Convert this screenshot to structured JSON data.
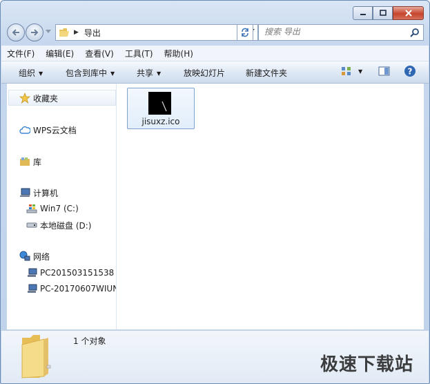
{
  "window": {
    "caption_buttons": [
      "minimize",
      "maximize",
      "close"
    ]
  },
  "address": {
    "crumb": "导出"
  },
  "search": {
    "placeholder": "搜索 导出"
  },
  "menu": [
    "文件(F)",
    "编辑(E)",
    "查看(V)",
    "工具(T)",
    "帮助(H)"
  ],
  "commands": {
    "organize": "组织",
    "include_in_library": "包含到库中",
    "share": "共享",
    "slideshow": "放映幻灯片",
    "new_folder": "新建文件夹"
  },
  "nav": {
    "favorites": "收藏夹",
    "wps_cloud": "WPS云文档",
    "library": "库",
    "computer": "计算机",
    "drive_c": "Win7 (C:)",
    "drive_d": "本地磁盘 (D:)",
    "network": "网络",
    "pc1": "PC201503151538",
    "pc2": "PC-20170607WIUN"
  },
  "files": [
    {
      "name": "jisuxz.ico",
      "icon": "black-ico-thumbnail"
    }
  ],
  "details": {
    "count": "1 个对象"
  },
  "watermark": "极速下载站"
}
